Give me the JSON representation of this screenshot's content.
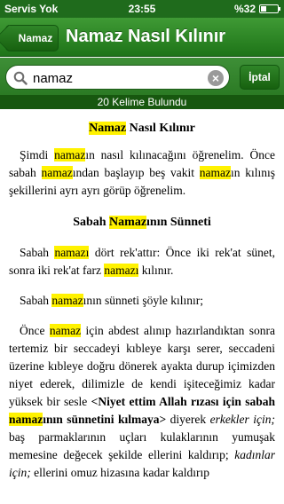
{
  "status_bar": {
    "carrier": "Servis Yok",
    "time": "23:55",
    "battery": "%32",
    "battery_level": 0.32
  },
  "nav": {
    "back_label": "Namaz",
    "title": "Namaz Nasıl Kılınır"
  },
  "search": {
    "value": "namaz",
    "cancel_label": "İptal"
  },
  "results_banner": "20 Kelime Bulundu",
  "article": {
    "title_1": {
      "hl": "Namaz",
      "rest": " Nasıl Kılınır"
    },
    "para_1": {
      "t1": "Şimdi ",
      "h1": "namaz",
      "t2": "ın nasıl kılınacağını öğrenelim. Önce sabah ",
      "h2": "namaz",
      "t3": "ından başlayıp beş vakit ",
      "h3": "namaz",
      "t4": "ın kılınış şekillerini ayrı ayrı görüp öğrenelim."
    },
    "title_2": {
      "t1": "Sabah ",
      "hl": "Namaz",
      "rest": "ının Sünneti"
    },
    "para_2": {
      "t1": "Sabah ",
      "h1": "namazı",
      "t2": " dört rek'attır: Önce iki rek'at sünet, sonra iki rek'at farz ",
      "h2": "namazı",
      "t3": " kılınır."
    },
    "para_3": {
      "t1": "Sabah ",
      "h1": "namaz",
      "t2": "ının sünneti şöyle kılınır;"
    },
    "para_4": {
      "t1": "Önce ",
      "h1": "namaz",
      "t2": " için abdest alınıp hazırlandıktan sonra tertemiz bir seccadeyi kıbleye karşı serer, seccadeni üzerine kıbleye doğru dönerek ayakta durup içimizden niyet ederek, dilimizle de kendi işiteceğimiz kadar yüksek bir sesle ",
      "b1": "<Niyet ettim Allah rızası için sabah ",
      "h2": "namaz",
      "b2": "ının sünnetini kılmaya>",
      "t3": " diyerek ",
      "i1": "erkekler için;",
      "t4": " baş parmaklarının uçları kulaklarının yumuşak memesine değecek şekilde ellerini kaldırıp; ",
      "i2": "kadınlar için;",
      "t5": " ellerini omuz hizasına kadar kaldırıp"
    }
  },
  "colors": {
    "bar_green": "#1e7418",
    "highlight": "#fff200"
  }
}
